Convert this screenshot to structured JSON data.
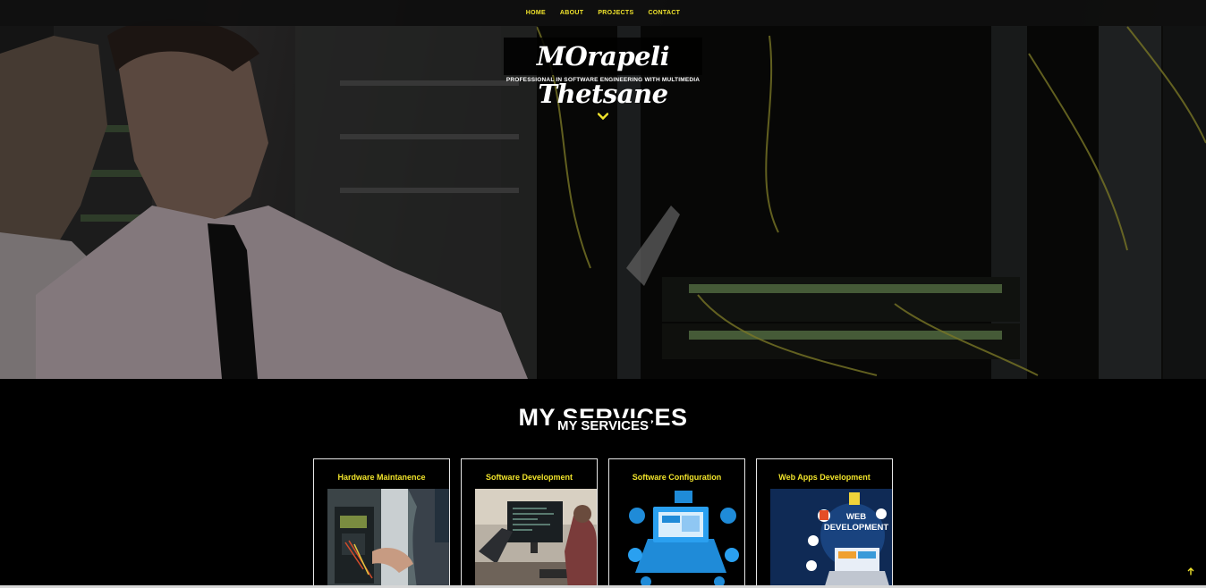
{
  "nav": {
    "items": [
      "HOME",
      "ABOUT",
      "PROJECTS",
      "CONTACT"
    ]
  },
  "hero": {
    "title": "MOrapeli Thetsane",
    "subtitle": "PROFESSIONAL IN SOFTWARE ENGINEERING WITH MULTIMEDIA",
    "scroll_icon": "chevron-down-icon"
  },
  "services": {
    "heading": "MY SERVICES",
    "subheading": "MY SERVICES",
    "cards": [
      {
        "title": "Hardware Maintanence"
      },
      {
        "title": "Software Development"
      },
      {
        "title": "Software Configuration"
      },
      {
        "title": "Web Apps Development",
        "image_text": "WEB DEVELOPMENT"
      }
    ]
  },
  "back_to_top_icon": "arrow-up-icon",
  "colors": {
    "accent": "#f0e32b",
    "background": "#000000",
    "text": "#ffffff"
  }
}
